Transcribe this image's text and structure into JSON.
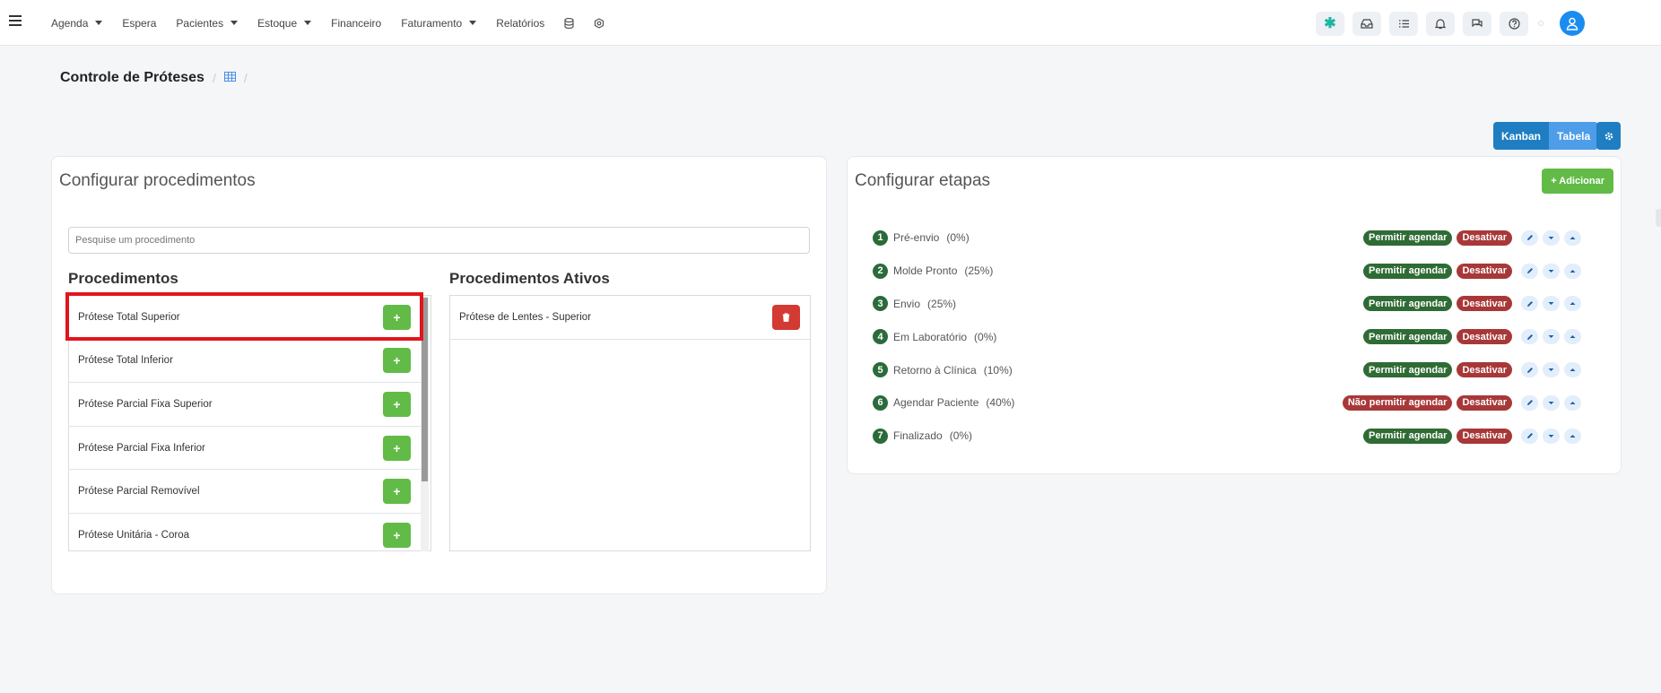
{
  "nav": {
    "items": [
      {
        "label": "Agenda",
        "dropdown": true
      },
      {
        "label": "Espera",
        "dropdown": false
      },
      {
        "label": "Pacientes",
        "dropdown": true
      },
      {
        "label": "Estoque",
        "dropdown": true
      },
      {
        "label": "Financeiro",
        "dropdown": false
      },
      {
        "label": "Faturamento",
        "dropdown": true
      },
      {
        "label": "Relatórios",
        "dropdown": false
      }
    ],
    "icons": [
      "database-icon",
      "settings-icon"
    ],
    "right_icons": [
      "asterisk-icon",
      "inbox-icon",
      "checklist-icon",
      "bell-icon",
      "chat-icon",
      "help-icon"
    ],
    "avatar": "user-avatar-icon"
  },
  "breadcrumb": {
    "title": "Controle de Próteses",
    "sep": "/",
    "icon": "table-grid-icon"
  },
  "view": {
    "kanban": "Kanban",
    "tabela": "Tabela",
    "gear": "gear-icon"
  },
  "procedures": {
    "title": "Configurar procedimentos",
    "search_placeholder": "Pesquise um procedimento",
    "list_title": "Procedimentos",
    "active_title": "Procedimentos Ativos",
    "items": [
      "Prótese Total Superior",
      "Prótese Total Inferior",
      "Prótese Parcial Fixa Superior",
      "Prótese Parcial Fixa Inferior",
      "Prótese Parcial Removível",
      "Prótese Unitária - Coroa"
    ],
    "active": [
      "Prótese de Lentes - Superior"
    ],
    "add_glyph": "+"
  },
  "stages": {
    "title": "Configurar etapas",
    "add_label": "+ Adicionar",
    "items": [
      {
        "n": "1",
        "name": "Pré-envio",
        "pct": "(0%)",
        "permit": "Permitir agendar",
        "permit_on": true
      },
      {
        "n": "2",
        "name": "Molde Pronto",
        "pct": "(25%)",
        "permit": "Permitir agendar",
        "permit_on": true
      },
      {
        "n": "3",
        "name": "Envio",
        "pct": "(25%)",
        "permit": "Permitir agendar",
        "permit_on": true
      },
      {
        "n": "4",
        "name": "Em Laboratório",
        "pct": "(0%)",
        "permit": "Permitir agendar",
        "permit_on": true
      },
      {
        "n": "5",
        "name": "Retorno à Clínica",
        "pct": "(10%)",
        "permit": "Permitir agendar",
        "permit_on": true
      },
      {
        "n": "6",
        "name": "Agendar Paciente",
        "pct": "(40%)",
        "permit": "Não permitir agendar",
        "permit_on": false
      },
      {
        "n": "7",
        "name": "Finalizado",
        "pct": "(0%)",
        "permit": "Permitir agendar",
        "permit_on": true
      }
    ],
    "deactivate": "Desativar"
  },
  "colors": {
    "green_btn": "#62bb47",
    "green_badge": "#2f6b34",
    "red_badge": "#a83838",
    "blue": "#1f7ec2",
    "highlight": "#e2151c"
  }
}
